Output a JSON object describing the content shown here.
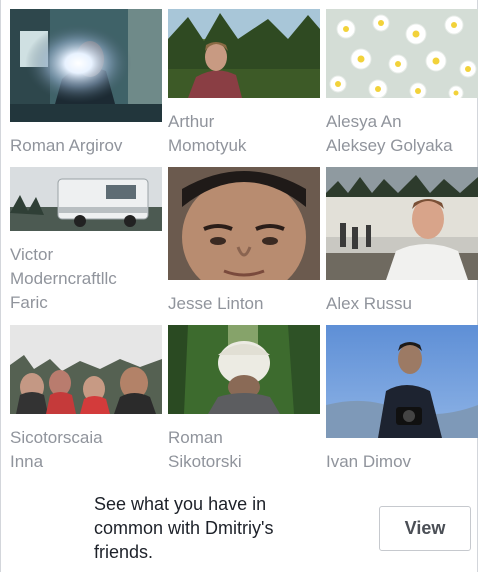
{
  "friends": [
    {
      "name": "Roman Argirov",
      "photo": "flash-selfie-photo"
    },
    {
      "name": "Arthur\nMomotyuk",
      "photo": "forest-portrait-photo"
    },
    {
      "name": "Alesya An\nAleksey Golyaka",
      "photo": "chamomile-flowers-photo"
    },
    {
      "name": "Victor\nModerncraftllc\nFaric",
      "photo": "truck-photo"
    },
    {
      "name": "Jesse Linton",
      "photo": "face-closeup-photo"
    },
    {
      "name": "Alex Russu",
      "photo": "lake-portrait-photo"
    },
    {
      "name": "Sicotorscaia\nInna",
      "photo": "family-selfie-photo"
    },
    {
      "name": "Roman\nSikotorski",
      "photo": "cap-back-photo"
    },
    {
      "name": "Ivan Dimov",
      "photo": "camera-man-photo"
    }
  ],
  "footer": {
    "text": "See what you have in common with Dmitriy's friends.",
    "view_label": "View"
  },
  "colors": {
    "name_text": "#90949c",
    "body_text": "#1d2129",
    "button_border": "#c6c9ce"
  }
}
